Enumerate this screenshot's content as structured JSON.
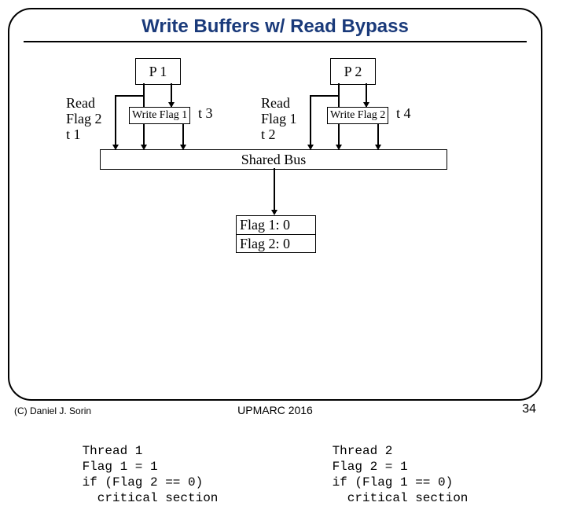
{
  "title": "Write Buffers w/ Read Bypass",
  "p1": {
    "label": "P 1",
    "read": "Read\nFlag 2\nt 1",
    "wbuf": "Write Flag 1",
    "t": "t 3"
  },
  "p2": {
    "label": "P 2",
    "read": "Read\nFlag 1\nt 2",
    "wbuf": "Write Flag 2",
    "t": "t 4"
  },
  "bus": "Shared Bus",
  "flags": {
    "f1": "Flag 1: 0",
    "f2": "Flag 2: 0"
  },
  "thread1": "Thread 1\nFlag 1 = 1\nif (Flag 2 == 0)\n  critical section",
  "thread2": "Thread 2\nFlag 2 = 1\nif (Flag 1 == 0)\n  critical section",
  "copyright": "(C) Daniel J. Sorin",
  "venue": "UPMARC 2016",
  "page": "34"
}
